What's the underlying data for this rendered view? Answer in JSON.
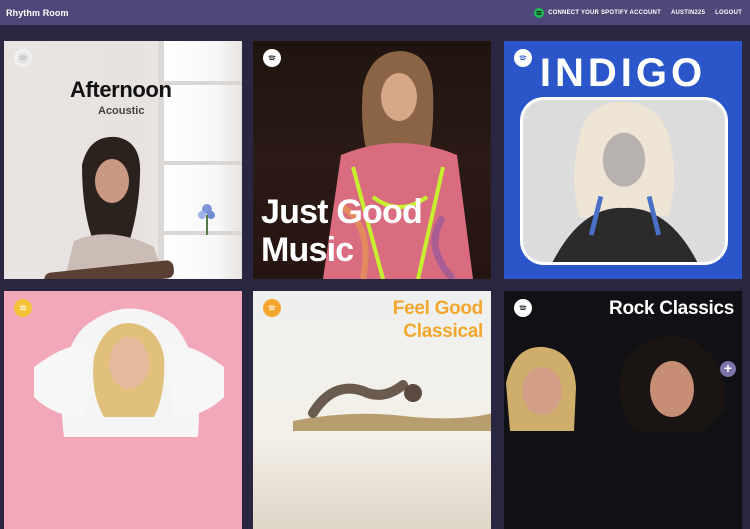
{
  "app": {
    "title": "Rhythm Room"
  },
  "nav": {
    "connect_label": "CONNECT YOUR SPOTIFY ACCOUNT",
    "username": "AUSTIN225",
    "logout_label": "LOGOUT"
  },
  "playlists": [
    {
      "title": "Afternoon",
      "subtitle": "Acoustic"
    },
    {
      "title_line1": "Just Good",
      "title_line2": "Music"
    },
    {
      "title": "INDIGO"
    },
    {
      "title": ""
    },
    {
      "title_line1": "Feel Good",
      "title_line2": "Classical"
    },
    {
      "title": "Rock Classics",
      "add_button": "+"
    }
  ],
  "colors": {
    "topbar": "#4f4778",
    "background": "#2a2540",
    "spotify_green": "#1db954",
    "indigo_blue": "#2a56c9",
    "classical_orange": "#f3a62d"
  },
  "icons": {
    "spotify": "spotify-icon",
    "add": "plus-icon"
  }
}
